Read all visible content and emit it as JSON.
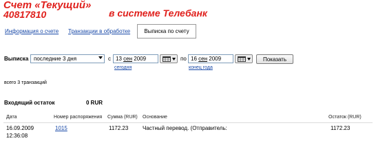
{
  "header": {
    "account_title": "Счет «Текущий»",
    "account_number": "40817810",
    "system_label": "в системе Телебанк"
  },
  "tabs": [
    {
      "label": "Информация о счете",
      "active": false
    },
    {
      "label": "Транзакции в обработке",
      "active": false
    },
    {
      "label": "Выписка по счету",
      "active": true
    }
  ],
  "filter": {
    "statement_label": "Выписка",
    "period_selected": "последние 3 дня",
    "from_label": "с",
    "from_day": "13",
    "from_month": "сен",
    "from_year": "2009",
    "to_label": "по",
    "to_day": "16",
    "to_month": "сен",
    "to_year": "2009",
    "today_link": "сегодня",
    "year_end_link": "конец года",
    "show_button": "Показать"
  },
  "summary": {
    "total_text": "всего 3 транзакций",
    "opening_balance_label": "Входящий остаток",
    "opening_balance_value": "0 RUR"
  },
  "table": {
    "headers": [
      "Дата",
      "Номер распоряжения",
      "Сумма (RUR)",
      "Основание",
      "Остаток (RUR)"
    ],
    "rows": [
      {
        "date": "16.09.2009",
        "time": "12:36:08",
        "order_number": "1015",
        "amount": "1172.23",
        "reason": "Частный перевод. (Отправитель:",
        "balance": "1172.23"
      }
    ]
  }
}
